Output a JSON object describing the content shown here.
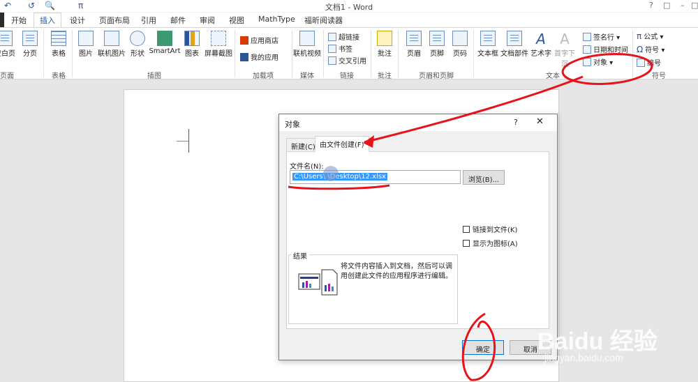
{
  "app": {
    "window_title": "文档1 - Word",
    "quick_access": [
      "↶",
      "↺",
      "🔍",
      "π"
    ],
    "window_controls": [
      "?",
      "□",
      "–",
      "□"
    ]
  },
  "tabs": [
    "开始",
    "插入",
    "设计",
    "页面布局",
    "引用",
    "邮件",
    "审阅",
    "视图",
    "MathType",
    "福昕阅读器"
  ],
  "active_tab": "插入",
  "ribbon": {
    "pages_group": {
      "btn1": "空白页",
      "btn2": "分页",
      "label": "页面"
    },
    "table_group": {
      "btn": "表格",
      "label": "表格"
    },
    "illustrations": {
      "b1": "图片",
      "b2": "联机图片",
      "b3": "形状",
      "b4": "SmartArt",
      "b5": "图表",
      "b6": "屏幕截图",
      "label": "插图"
    },
    "addins": {
      "store": "应用商店",
      "myapps": "我的应用",
      "label": "加载项"
    },
    "media": {
      "btn": "联机视频",
      "label": "媒体"
    },
    "links": {
      "hyperlink": "超链接",
      "bookmark": "书签",
      "crossref": "交叉引用",
      "label": "链接"
    },
    "comments": {
      "btn": "批注",
      "label": "批注"
    },
    "header_footer": {
      "header": "页眉",
      "footer": "页脚",
      "pagenum": "页码",
      "label": "页眉和页脚"
    },
    "text": {
      "textbox": "文本框",
      "parts": "文档部件",
      "wordart": "艺术字",
      "dropcap": "首字下沉",
      "sigline": "签名行",
      "datetime": "日期和时间",
      "object": "对象",
      "label": "文本"
    },
    "symbols": {
      "equation": "公式",
      "symbol": "符号",
      "number": "编号",
      "label": "符号"
    }
  },
  "dialog": {
    "title": "对象",
    "help": "?",
    "close": "✕",
    "tab_new": "新建(C)",
    "tab_fromfile": "由文件创建(F)",
    "filename_label": "文件名(N):",
    "filename_value": "C:\\Users\\ \\Desktop\\12.xlsx",
    "browse": "浏览(B)...",
    "link_to_file": "链接到文件(K)",
    "display_as_icon": "显示为图标(A)",
    "result_caption": "结果",
    "result_text": "将文件内容插入到文档，然后可以调用创建此文件的应用程序进行编辑。",
    "ok": "确定",
    "cancel": "取消"
  },
  "watermark": {
    "brand": "Baidu 经验",
    "url": "jingyan.baidu.com"
  },
  "annotation_color": "#e8121b"
}
